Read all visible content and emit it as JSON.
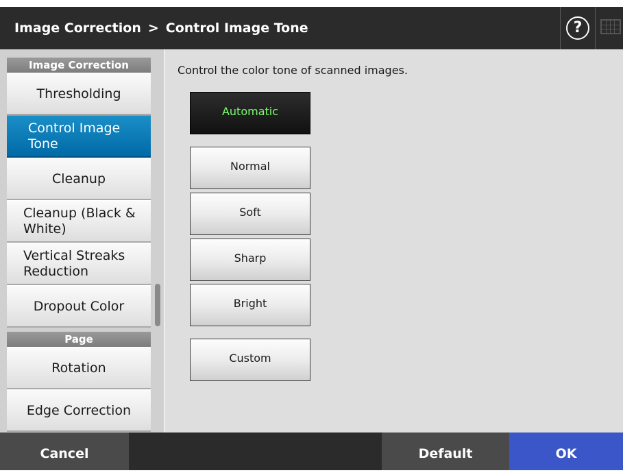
{
  "header": {
    "title_part1": "Image Correction",
    "separator": ">",
    "title_part2": "Control Image Tone",
    "help_glyph": "?",
    "icons": [
      "help-icon",
      "keyboard-icon"
    ]
  },
  "sidebar": {
    "section_image_correction": "Image Correction",
    "section_page": "Page",
    "items": [
      {
        "label": "Thresholding"
      },
      {
        "label": "Control Image Tone"
      },
      {
        "label": "Cleanup"
      },
      {
        "label": "Cleanup (Black & White)"
      },
      {
        "label": "Vertical Streaks Reduction"
      },
      {
        "label": "Dropout Color"
      },
      {
        "label": "Rotation"
      },
      {
        "label": "Edge Correction"
      }
    ],
    "active_item": "Control Image Tone"
  },
  "main": {
    "instruction": "Control the color tone of scanned images.",
    "tone_options": [
      "Automatic",
      "Normal",
      "Soft",
      "Sharp",
      "Bright",
      "Custom"
    ],
    "selected_option": "Automatic"
  },
  "footer": {
    "cancel_label": "Cancel",
    "default_label": "Default",
    "ok_label": "OK"
  },
  "colors": {
    "header_bg": "#2b2b2b",
    "active_nav": "#0a78b5",
    "selected_text": "#7dff6e",
    "ok_button": "#3a56c8"
  }
}
